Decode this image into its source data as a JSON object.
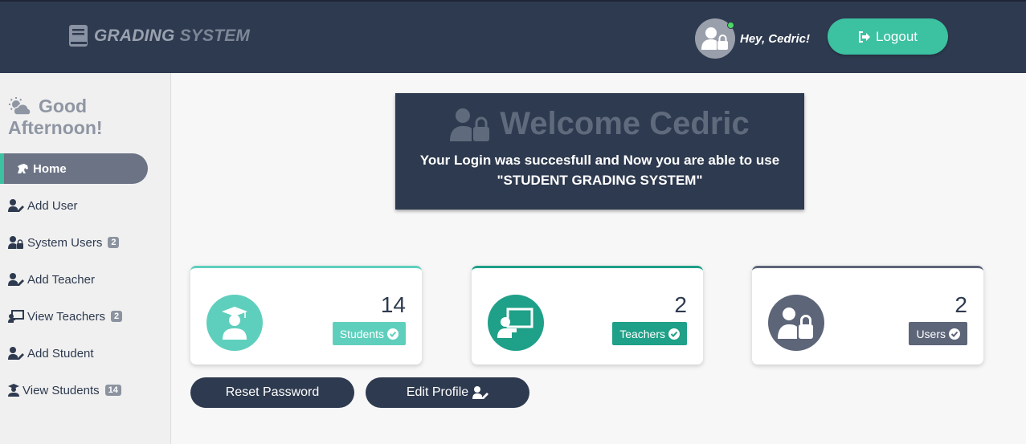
{
  "header": {
    "brand_part1": "GRADING",
    "brand_part2": "SYSTEM",
    "greeting": "Hey, Cedric!",
    "logout_label": "Logout",
    "online_status_color": "#4cd964"
  },
  "sidebar": {
    "greeting_line1": "Good",
    "greeting_line2": "Afternoon!",
    "items": [
      {
        "label": "Home",
        "icon": "horse-icon",
        "active": true
      },
      {
        "label": "Add User",
        "icon": "user-edit-icon"
      },
      {
        "label": "System Users",
        "icon": "user-lock-icon",
        "badge": "2"
      },
      {
        "label": "Add Teacher",
        "icon": "user-edit-icon"
      },
      {
        "label": "View Teachers",
        "icon": "chalkboard-teacher-icon",
        "badge": "2"
      },
      {
        "label": "Add Student",
        "icon": "user-edit-icon"
      },
      {
        "label": "View Students",
        "icon": "user-graduate-icon",
        "badge": "14"
      }
    ]
  },
  "welcome": {
    "title": "Welcome Cedric",
    "message_line1": "Your Login was succesfull and Now you are able to use",
    "message_line2": "\"STUDENT GRADING SYSTEM\""
  },
  "cards": [
    {
      "count": "14",
      "label": "Students",
      "color": "#5fcfbd",
      "icon": "user-graduate-icon"
    },
    {
      "count": "2",
      "label": "Teachers",
      "color": "#1fa088",
      "icon": "chalkboard-teacher-icon"
    },
    {
      "count": "2",
      "label": "Users",
      "color": "#5d6578",
      "icon": "user-lock-icon"
    }
  ],
  "actions": {
    "reset_password": "Reset Password",
    "edit_profile": "Edit Profile"
  },
  "colors": {
    "header_bg": "#2e3a4f",
    "accent": "#3cc1a1"
  }
}
